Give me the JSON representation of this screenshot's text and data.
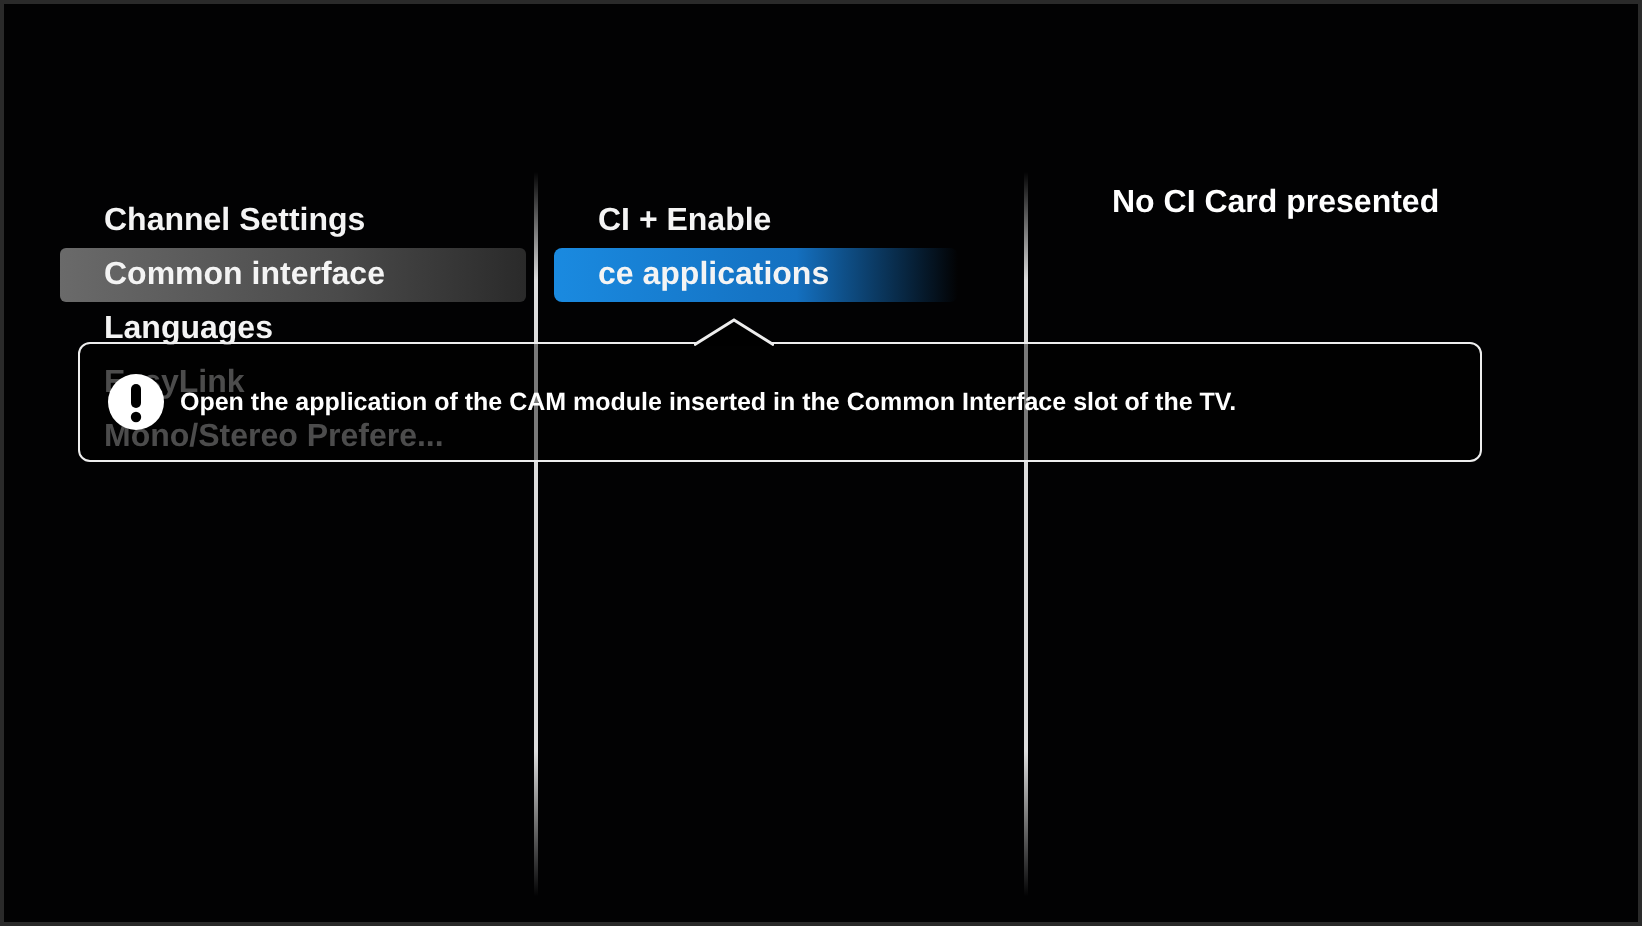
{
  "menu": {
    "items": [
      {
        "label": "Channel Settings",
        "selected": false,
        "obscured": false
      },
      {
        "label": "Common interface",
        "selected": true,
        "obscured": false
      },
      {
        "label": "Languages",
        "selected": false,
        "obscured": false
      },
      {
        "label": "EasyLink",
        "selected": false,
        "obscured": true
      },
      {
        "label": "Mono/Stereo Prefere...",
        "selected": false,
        "obscured": true
      }
    ]
  },
  "submenu": {
    "items": [
      {
        "label": "CI + Enable",
        "selected": false
      },
      {
        "label": "ce applications",
        "selected": true
      }
    ]
  },
  "detail": {
    "text": "No CI Card presented"
  },
  "help_tooltip": {
    "message": "Open the application of the CAM module inserted in the Common Interface slot of the TV."
  }
}
